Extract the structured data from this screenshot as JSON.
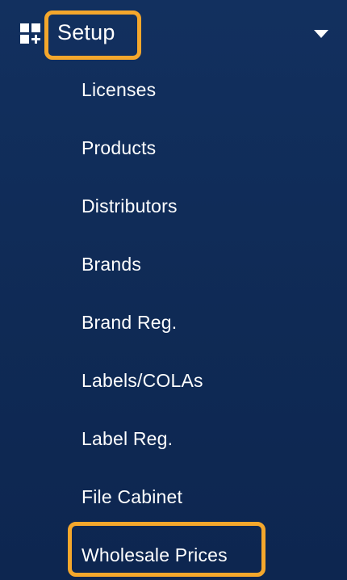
{
  "sidebar": {
    "section": {
      "label": "Setup",
      "icon": "dashboard-add-icon",
      "toggle_icon": "caret-down-icon",
      "highlight_color": "#f4a72c"
    },
    "items": [
      {
        "label": "Licenses"
      },
      {
        "label": "Products"
      },
      {
        "label": "Distributors"
      },
      {
        "label": "Brands"
      },
      {
        "label": "Brand Reg."
      },
      {
        "label": "Labels/COLAs"
      },
      {
        "label": "Label Reg."
      },
      {
        "label": "File Cabinet"
      },
      {
        "label": "Wholesale Prices",
        "highlighted": true
      }
    ]
  }
}
